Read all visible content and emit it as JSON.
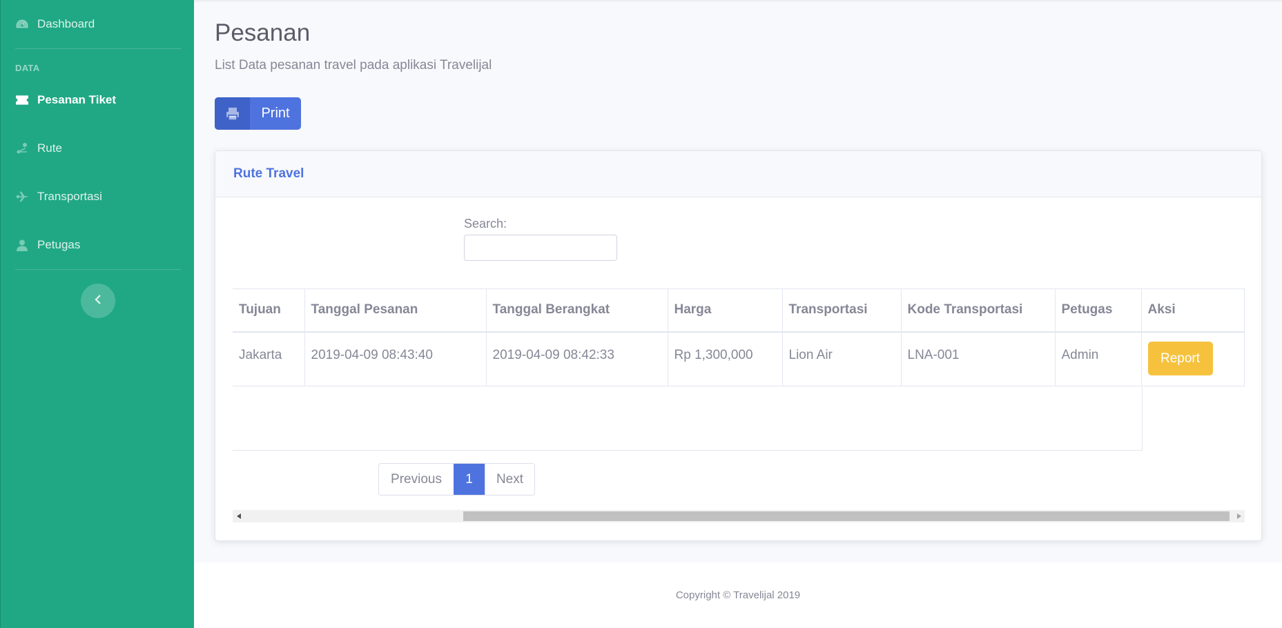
{
  "sidebar": {
    "items": [
      {
        "label": "Dashboard",
        "icon": "dashboard-icon"
      },
      {
        "label": "Pesanan Tiket",
        "icon": "ticket-icon",
        "active": true
      },
      {
        "label": "Rute",
        "icon": "route-icon"
      },
      {
        "label": "Transportasi",
        "icon": "plane-icon"
      },
      {
        "label": "Petugas",
        "icon": "user-icon"
      }
    ],
    "heading": "DATA",
    "toggle_icon": "chevron-left-icon"
  },
  "page": {
    "title": "Pesanan",
    "subtitle": "List Data pesanan travel pada aplikasi Travelijal",
    "print_label": "Print"
  },
  "card": {
    "title": "Rute Travel",
    "search_label": "Search:",
    "search_value": ""
  },
  "table": {
    "columns": [
      "Tujuan",
      "Tanggal Pesanan",
      "Tanggal Berangkat",
      "Harga",
      "Transportasi",
      "Kode Transportasi",
      "Petugas",
      "Aksi"
    ],
    "rows": [
      [
        "Jakarta",
        "2019-04-09 08:43:40",
        "2019-04-09 08:42:33",
        "Rp 1,300,000",
        "Lion Air",
        "LNA-001",
        "Admin",
        "Report"
      ]
    ]
  },
  "pagination": {
    "previous": "Previous",
    "current": "1",
    "next": "Next"
  },
  "footer": {
    "copyright": "Copyright © Travelijal 2019"
  },
  "colors": {
    "sidebar": "#20a884",
    "primary": "#4e73df",
    "warning": "#f6c23e"
  }
}
